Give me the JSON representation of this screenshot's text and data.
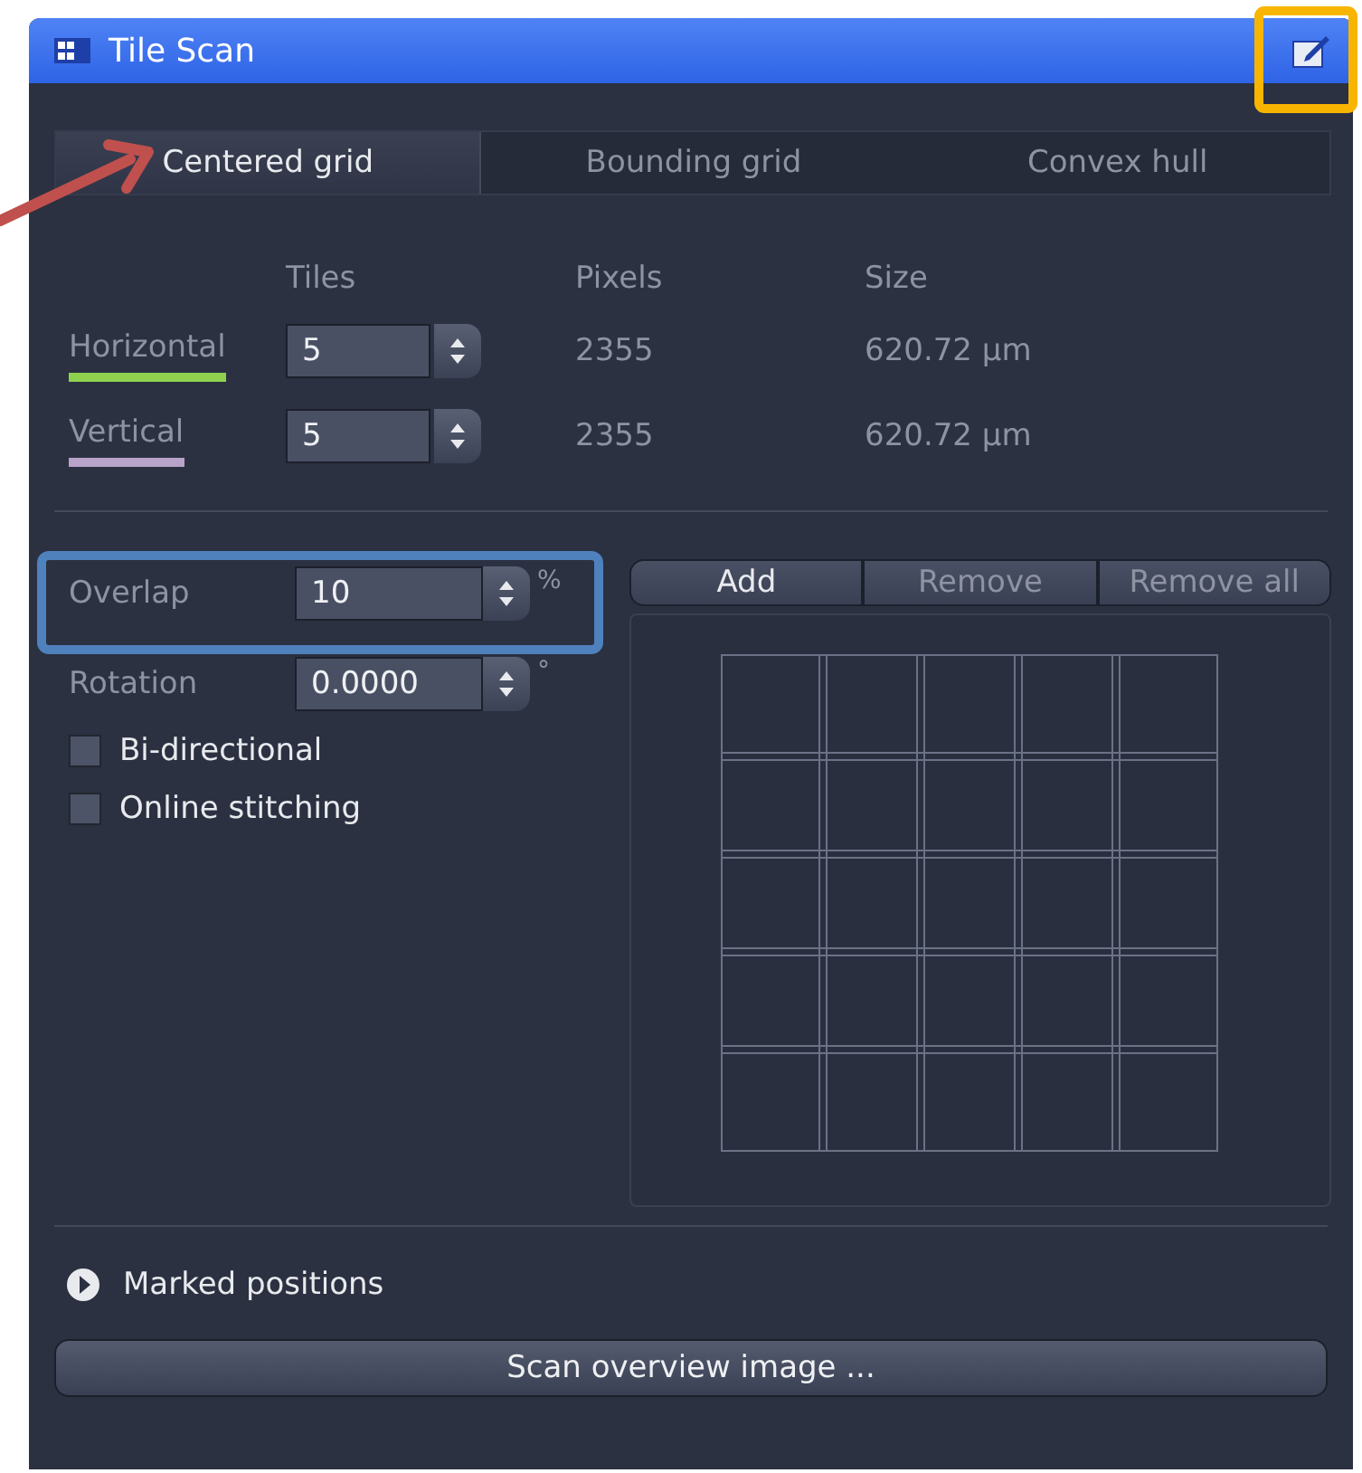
{
  "window": {
    "title": "Tile Scan"
  },
  "tabs": [
    {
      "label": "Centered grid",
      "selected": true
    },
    {
      "label": "Bounding grid",
      "selected": false
    },
    {
      "label": "Convex hull",
      "selected": false
    }
  ],
  "tiles_table": {
    "columns": [
      "Tiles",
      "Pixels",
      "Size"
    ],
    "rows": [
      {
        "label": "Horizontal",
        "value": "5",
        "pixels": "2355",
        "size": "620.72 µm",
        "color": "#8fd14f"
      },
      {
        "label": "Vertical",
        "value": "5",
        "pixels": "2355",
        "size": "620.72 µm",
        "color": "#b9a3c9"
      }
    ]
  },
  "settings": [
    {
      "label": "Overlap",
      "value": "10",
      "unit": "%"
    },
    {
      "label": "Rotation",
      "value": "0.0000",
      "unit": "°"
    }
  ],
  "checkboxes": [
    {
      "label": "Bi-directional",
      "checked": false
    },
    {
      "label": "Online stitching",
      "checked": false
    }
  ],
  "position_buttons": [
    {
      "label": "Add",
      "disabled": false
    },
    {
      "label": "Remove",
      "disabled": true
    },
    {
      "label": "Remove all",
      "disabled": true
    }
  ],
  "marked_positions": {
    "label": "Marked positions",
    "expanded": false
  },
  "scan_button": "Scan overview image ..."
}
